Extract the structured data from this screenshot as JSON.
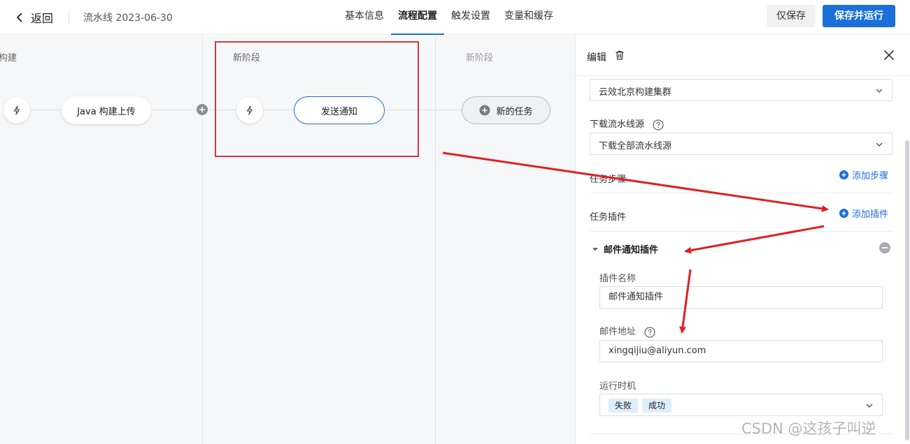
{
  "header": {
    "back_label": "返回",
    "pipeline_name": "流水线 2023-06-30",
    "tabs": [
      {
        "label": "基本信息",
        "active": false
      },
      {
        "label": "流程配置",
        "active": true
      },
      {
        "label": "触发设置",
        "active": false
      },
      {
        "label": "变量和缓存",
        "active": false
      }
    ],
    "save_only_label": "仅保存",
    "save_run_label": "保存并运行"
  },
  "canvas": {
    "stages": [
      {
        "title": "构建",
        "job": "Java 构建上传"
      },
      {
        "title": "新阶段",
        "job": "发送通知"
      },
      {
        "title": "新阶段",
        "job": "新的任务"
      }
    ]
  },
  "panel": {
    "title": "编辑",
    "cluster_select": "云效北京构建集群",
    "download_source_label": "下载流水线源",
    "download_source_value": "下载全部流水线源",
    "task_steps_label": "任务步骤",
    "add_step_label": "添加步骤",
    "task_plugins_label": "任务插件",
    "add_plugin_label": "添加插件",
    "plugin": {
      "name": "邮件通知插件",
      "plugin_name_label": "插件名称",
      "plugin_name_value": "邮件通知插件",
      "email_label": "邮件地址",
      "email_value": "xingqijiu@aliyun.com",
      "run_timing_label": "运行时机",
      "run_timing_tags": [
        "失败",
        "成功"
      ]
    }
  },
  "colors": {
    "primary": "#1b6fd8",
    "annotation": "#d9363e"
  },
  "watermark": "CSDN @这孩子叫逆"
}
